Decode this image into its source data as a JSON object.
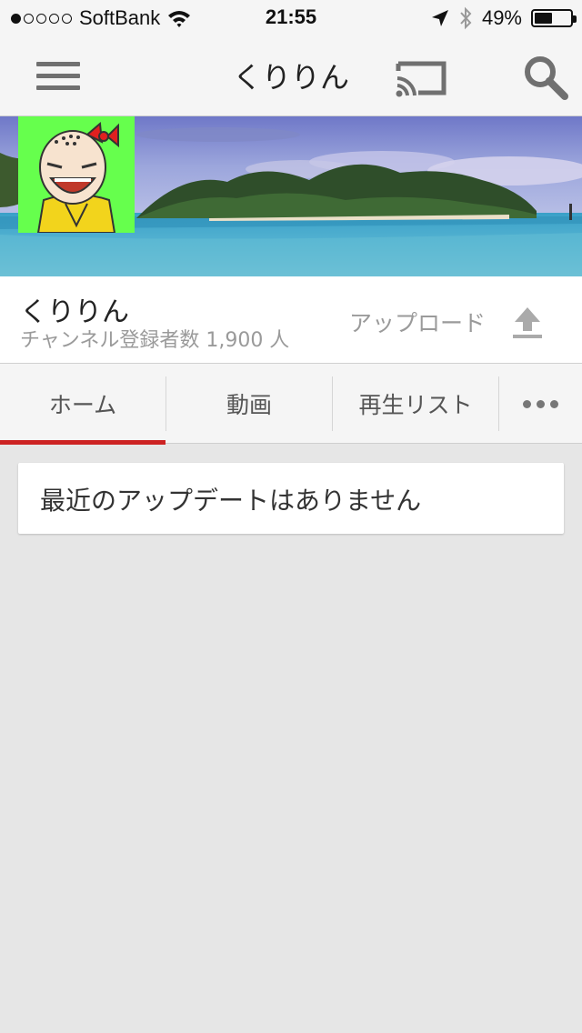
{
  "status_bar": {
    "signal_dots": [
      true,
      false,
      false,
      false,
      false
    ],
    "carrier": "SoftBank",
    "time": "21:55",
    "battery_percent": "49%",
    "battery_level": 0.49,
    "icons": [
      "wifi-icon",
      "location-arrow-icon",
      "bluetooth-icon",
      "battery-icon"
    ]
  },
  "app_bar": {
    "title": "くりりん",
    "icons": [
      "menu-icon",
      "cast-icon",
      "search-icon"
    ]
  },
  "channel": {
    "name": "くりりん",
    "subscribers": "チャンネル登録者数 1,900 人",
    "upload_label": "アップロード"
  },
  "tabs": {
    "items": [
      {
        "label": "ホーム",
        "active": true
      },
      {
        "label": "動画",
        "active": false
      },
      {
        "label": "再生リスト",
        "active": false
      }
    ],
    "more_icon": "more-horizontal-icon"
  },
  "feed": {
    "empty_message": "最近のアップデートはありません"
  },
  "colors": {
    "accent": "#cc2222",
    "avatar_bg": "#66ff4d",
    "background": "#e6e6e6",
    "bar": "#f5f5f5"
  }
}
